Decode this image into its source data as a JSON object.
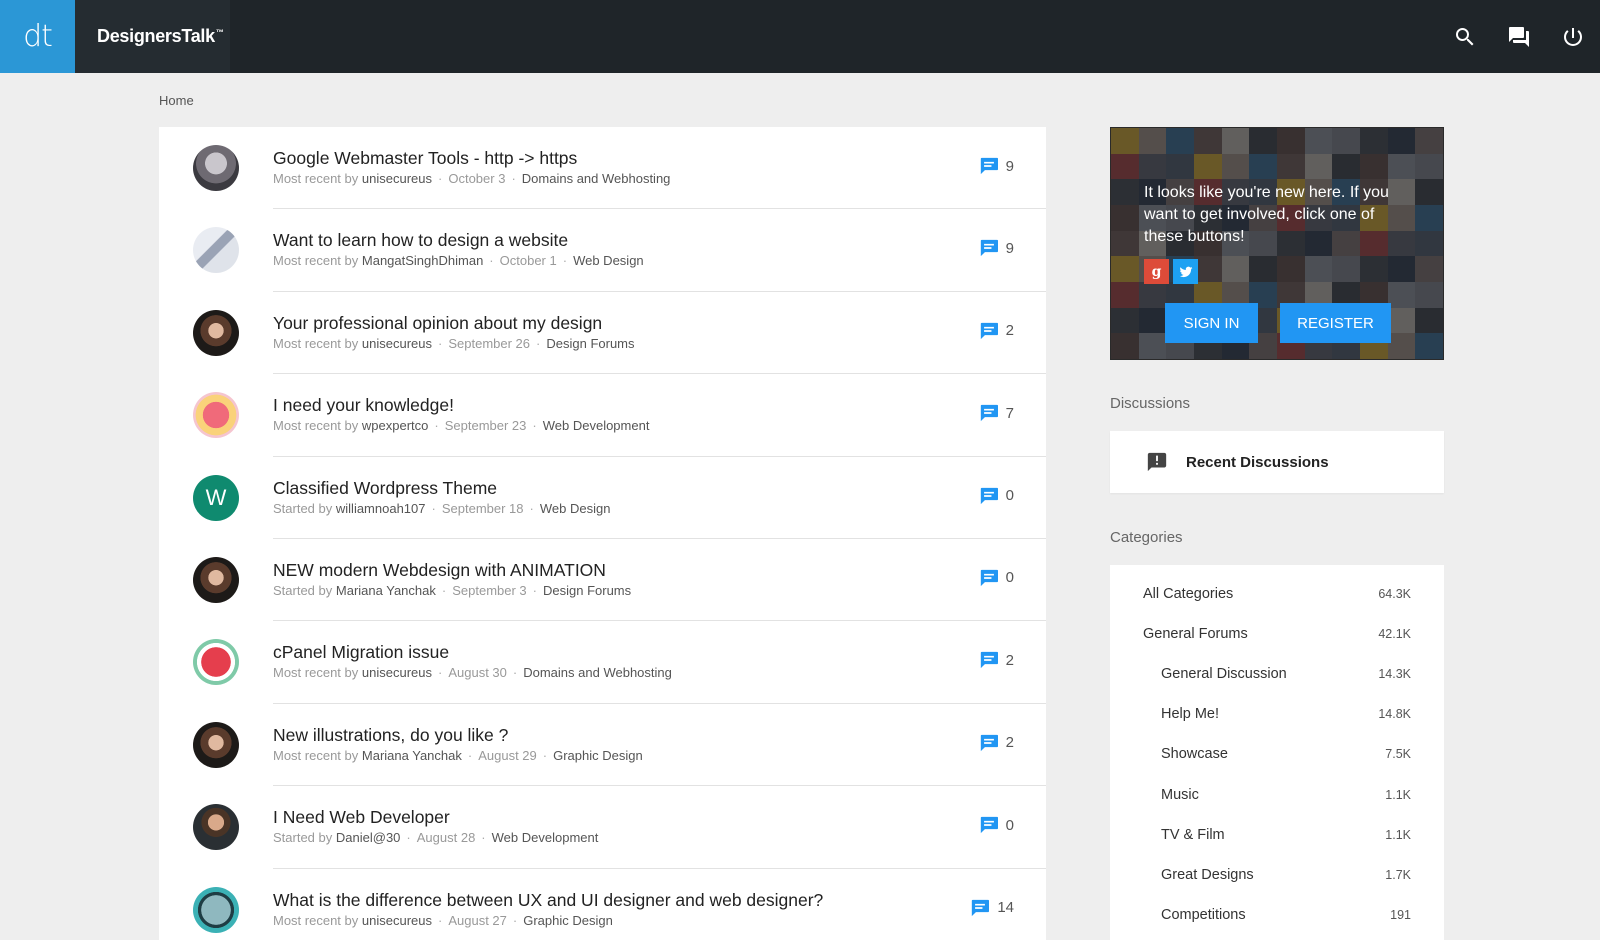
{
  "app": {
    "logo_text": "dt",
    "brand_name": "DesignersTalk",
    "brand_mark": "™",
    "icons": [
      "search-icon",
      "chat-icon",
      "power-icon"
    ]
  },
  "breadcrumb": {
    "home": "Home"
  },
  "discussions": [
    {
      "title": "Google Webmaster Tools - http -> https",
      "prefix": "Most recent by",
      "author": "unisecureus",
      "date": "October 3",
      "category": "Domains and Webhosting",
      "count": "9",
      "avatar": "photo-man-grey"
    },
    {
      "title": "Want to learn how to design a website",
      "prefix": "Most recent by",
      "author": "MangatSinghDhiman",
      "date": "October 1",
      "category": "Web Design",
      "count": "9",
      "avatar": "photo-desk"
    },
    {
      "title": "Your professional opinion about my design",
      "prefix": "Most recent by",
      "author": "unisecureus",
      "date": "September 26",
      "category": "Design Forums",
      "count": "2",
      "avatar": "photo-woman"
    },
    {
      "title": "I need your knowledge!",
      "prefix": "Most recent by",
      "author": "wpexpertco",
      "date": "September 23",
      "category": "Web Development",
      "count": "7",
      "avatar": "emoji-pink"
    },
    {
      "title": "Classified Wordpress Theme",
      "prefix": "Started by",
      "author": "williamnoah107",
      "date": "September 18",
      "category": "Web Design",
      "count": "0",
      "avatar": "letter-w",
      "avatar_letter": "W"
    },
    {
      "title": "NEW modern Webdesign with ANIMATION",
      "prefix": "Started by",
      "author": "Mariana Yanchak",
      "date": "September 3",
      "category": "Design Forums",
      "count": "0",
      "avatar": "photo-woman"
    },
    {
      "title": "cPanel Migration issue",
      "prefix": "Most recent by",
      "author": "unisecureus",
      "date": "August 30",
      "category": "Domains and Webhosting",
      "count": "2",
      "avatar": "emoji-red"
    },
    {
      "title": "New illustrations, do you like ?",
      "prefix": "Most recent by",
      "author": "Mariana Yanchak",
      "date": "August 29",
      "category": "Graphic Design",
      "count": "2",
      "avatar": "photo-woman"
    },
    {
      "title": "I Need Web Developer",
      "prefix": "Started by",
      "author": "Daniel@30",
      "date": "August 28",
      "category": "Web Development",
      "count": "0",
      "avatar": "photo-man"
    },
    {
      "title": "What is the difference between UX and UI designer and web designer?",
      "prefix": "Most recent by",
      "author": "unisecureus",
      "date": "August 27",
      "category": "Graphic Design",
      "count": "14",
      "avatar": "emoji-teal"
    }
  ],
  "welcome": {
    "message": "It looks like you're new here. If you want to get involved, click one of these buttons!",
    "google_label": "g",
    "sign_in": "SIGN IN",
    "register": "REGISTER"
  },
  "sidebar": {
    "discussions_heading": "Discussions",
    "recent_discussions": "Recent Discussions",
    "categories_heading": "Categories",
    "categories": [
      {
        "name": "All Categories",
        "count": "64.3K",
        "level": 0
      },
      {
        "name": "General Forums",
        "count": "42.1K",
        "level": 0
      },
      {
        "name": "General Discussion",
        "count": "14.3K",
        "level": 1
      },
      {
        "name": "Help Me!",
        "count": "14.8K",
        "level": 1
      },
      {
        "name": "Showcase",
        "count": "7.5K",
        "level": 1
      },
      {
        "name": "Music",
        "count": "1.1K",
        "level": 1
      },
      {
        "name": "TV & Film",
        "count": "1.1K",
        "level": 1
      },
      {
        "name": "Great Designs",
        "count": "1.7K",
        "level": 1
      },
      {
        "name": "Competitions",
        "count": "191",
        "level": 1
      }
    ]
  },
  "colors": {
    "accent": "#2196f3",
    "topbar": "#1f2529",
    "logo_bg": "#2b97d6",
    "google": "#dd4b39",
    "twitter": "#1da1f2"
  }
}
